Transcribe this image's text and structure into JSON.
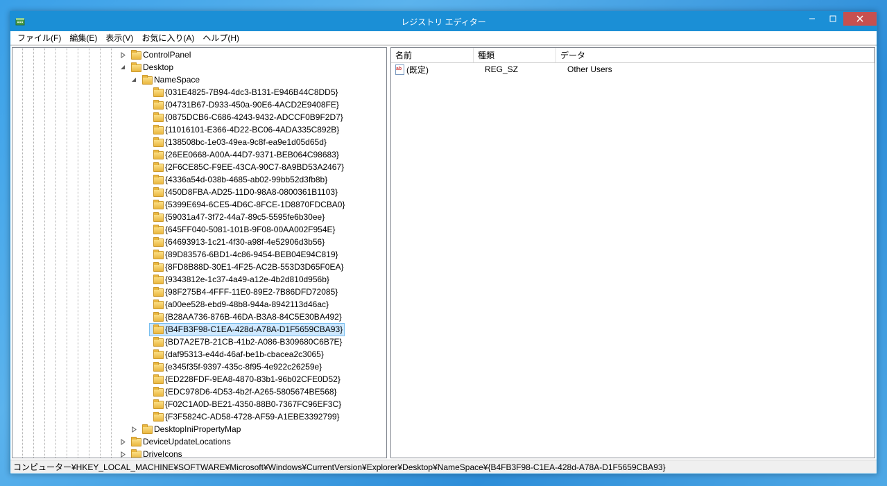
{
  "window": {
    "title": "レジストリ エディター"
  },
  "menu": {
    "file": "ファイル(F)",
    "edit": "編集(E)",
    "view": "表示(V)",
    "favorites": "お気に入り(A)",
    "help": "ヘルプ(H)"
  },
  "tree": [
    {
      "level": 10,
      "exp": "closed",
      "label": "ControlPanel"
    },
    {
      "level": 10,
      "exp": "open",
      "label": "Desktop"
    },
    {
      "level": 11,
      "exp": "open",
      "label": "NameSpace"
    },
    {
      "level": 12,
      "exp": "none",
      "label": "{031E4825-7B94-4dc3-B131-E946B44C8DD5}"
    },
    {
      "level": 12,
      "exp": "none",
      "label": "{04731B67-D933-450a-90E6-4ACD2E9408FE}"
    },
    {
      "level": 12,
      "exp": "none",
      "label": "{0875DCB6-C686-4243-9432-ADCCF0B9F2D7}"
    },
    {
      "level": 12,
      "exp": "none",
      "label": "{11016101-E366-4D22-BC06-4ADA335C892B}"
    },
    {
      "level": 12,
      "exp": "none",
      "label": "{138508bc-1e03-49ea-9c8f-ea9e1d05d65d}"
    },
    {
      "level": 12,
      "exp": "none",
      "label": "{26EE0668-A00A-44D7-9371-BEB064C98683}"
    },
    {
      "level": 12,
      "exp": "none",
      "label": "{2F6CE85C-F9EE-43CA-90C7-8A9BD53A2467}"
    },
    {
      "level": 12,
      "exp": "none",
      "label": "{4336a54d-038b-4685-ab02-99bb52d3fb8b}"
    },
    {
      "level": 12,
      "exp": "none",
      "label": "{450D8FBA-AD25-11D0-98A8-0800361B1103}"
    },
    {
      "level": 12,
      "exp": "none",
      "label": "{5399E694-6CE5-4D6C-8FCE-1D8870FDCBA0}"
    },
    {
      "level": 12,
      "exp": "none",
      "label": "{59031a47-3f72-44a7-89c5-5595fe6b30ee}"
    },
    {
      "level": 12,
      "exp": "none",
      "label": "{645FF040-5081-101B-9F08-00AA002F954E}"
    },
    {
      "level": 12,
      "exp": "none",
      "label": "{64693913-1c21-4f30-a98f-4e52906d3b56}"
    },
    {
      "level": 12,
      "exp": "none",
      "label": "{89D83576-6BD1-4c86-9454-BEB04E94C819}"
    },
    {
      "level": 12,
      "exp": "none",
      "label": "{8FD8B88D-30E1-4F25-AC2B-553D3D65F0EA}"
    },
    {
      "level": 12,
      "exp": "none",
      "label": "{9343812e-1c37-4a49-a12e-4b2d810d956b}"
    },
    {
      "level": 12,
      "exp": "none",
      "label": "{98F275B4-4FFF-11E0-89E2-7B86DFD72085}"
    },
    {
      "level": 12,
      "exp": "none",
      "label": "{a00ee528-ebd9-48b8-944a-8942113d46ac}"
    },
    {
      "level": 12,
      "exp": "none",
      "label": "{B28AA736-876B-46DA-B3A8-84C5E30BA492}"
    },
    {
      "level": 12,
      "exp": "none",
      "label": "{B4FB3F98-C1EA-428d-A78A-D1F5659CBA93}",
      "selected": true
    },
    {
      "level": 12,
      "exp": "none",
      "label": "{BD7A2E7B-21CB-41b2-A086-B309680C6B7E}"
    },
    {
      "level": 12,
      "exp": "none",
      "label": "{daf95313-e44d-46af-be1b-cbacea2c3065}"
    },
    {
      "level": 12,
      "exp": "none",
      "label": "{e345f35f-9397-435c-8f95-4e922c26259e}"
    },
    {
      "level": 12,
      "exp": "none",
      "label": "{ED228FDF-9EA8-4870-83b1-96b02CFE0D52}"
    },
    {
      "level": 12,
      "exp": "none",
      "label": "{EDC978D6-4D53-4b2f-A265-5805674BE568}"
    },
    {
      "level": 12,
      "exp": "none",
      "label": "{F02C1A0D-BE21-4350-88B0-7367FC96EF3C}"
    },
    {
      "level": 12,
      "exp": "none",
      "label": "{F3F5824C-AD58-4728-AF59-A1EBE3392799}"
    },
    {
      "level": 11,
      "exp": "closed",
      "label": "DesktopIniPropertyMap"
    },
    {
      "level": 10,
      "exp": "closed",
      "label": "DeviceUpdateLocations"
    },
    {
      "level": 10,
      "exp": "closed",
      "label": "DriveIcons",
      "partial": true
    }
  ],
  "list": {
    "columns": {
      "name": "名前",
      "type": "種類",
      "data": "データ"
    },
    "rows": [
      {
        "name": "(既定)",
        "type": "REG_SZ",
        "data": "Other Users"
      }
    ]
  },
  "statusbar": "コンピューター¥HKEY_LOCAL_MACHINE¥SOFTWARE¥Microsoft¥Windows¥CurrentVersion¥Explorer¥Desktop¥NameSpace¥{B4FB3F98-C1EA-428d-A78A-D1F5659CBA93}"
}
